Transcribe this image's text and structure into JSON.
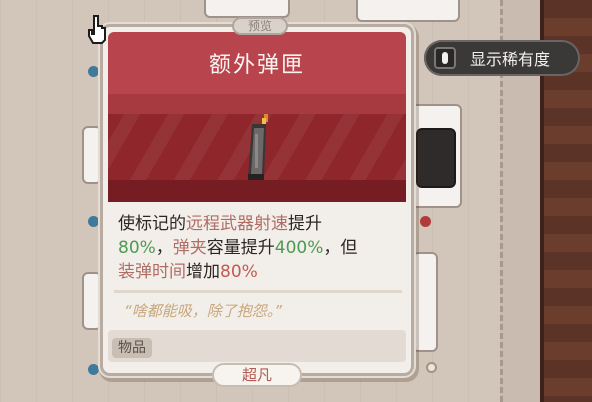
{
  "controls": {
    "show_rarity_label": "显示稀有度"
  },
  "tooltip": {
    "preview_tab": "预览",
    "title": "额外弹匣",
    "description": {
      "p1": "使标记的",
      "kw1": "远程武器射速",
      "p2": "提升",
      "v1": "80%",
      "p3": "，",
      "kw2": "弹夹",
      "p4": "容量提升",
      "v2": "400%",
      "p5": "，但",
      "kw3": "装弹时间",
      "p6": "增加",
      "v3": "80%"
    },
    "flavor": "“啥都能吸，除了抱怨。”",
    "item_type": "物品",
    "rarity": "超凡"
  },
  "colors": {
    "header_red": "#b8454d",
    "art_red": "#8e262b",
    "positive_green": "#4d9a52",
    "negative_red": "#c35b54",
    "keyword": "#b16d65",
    "flavor": "#c8a77c",
    "rarity_text": "#b25a52"
  },
  "icons": {
    "cursor": "hand-pointer-icon",
    "rarity_toggle": "toggle-switch-icon",
    "item_art": "ammo-magazine-icon"
  }
}
